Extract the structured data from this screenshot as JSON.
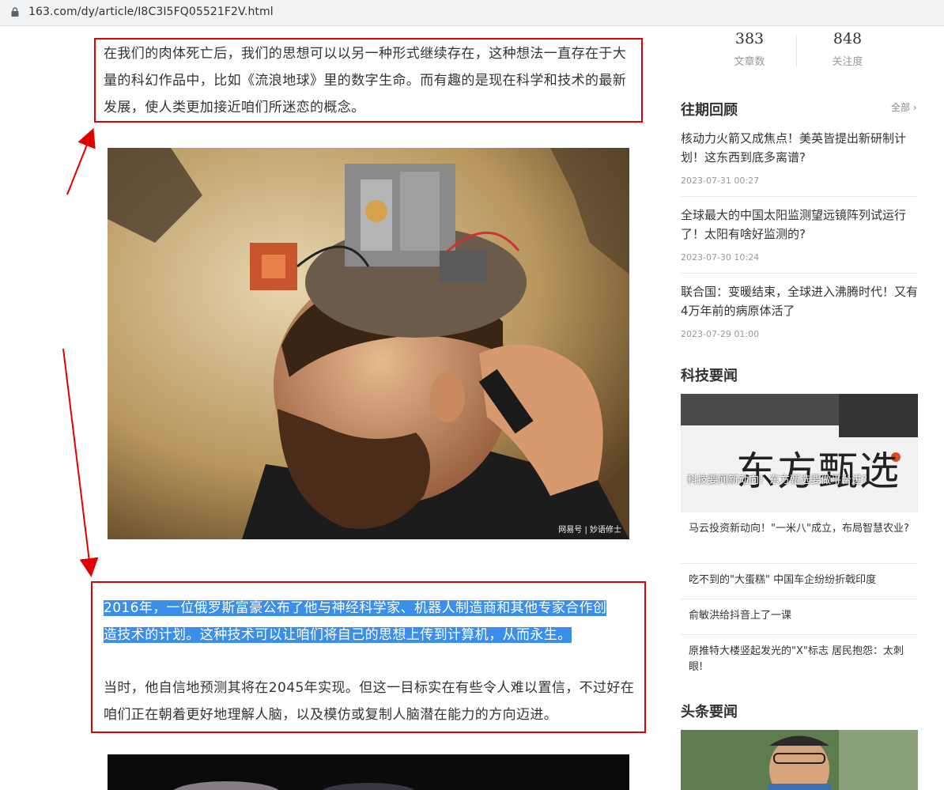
{
  "browser": {
    "url": "163.com/dy/article/I8C3I5FQ05521F2V.html"
  },
  "article": {
    "para1": "在我们的肉体死亡后，我们的思想可以以另一种形式继续存在，这种想法一直存在于大量的科幻作品中，比如《流浪地球》里的数字生命。而有趣的是现在科学和技术的最新发展，使人类更加接近咱们所迷恋的概念。",
    "image1_watermark": "网易号 | 妙语修士",
    "para2_line1": "2016年，一位俄罗斯富豪公布了他与神经科学家、机器人制造商和其他专家合作创",
    "para2_line2": "造技术的计划。这种技术可以让咱们将自己的思想上传到计算机，从而永生。",
    "para3": "当时，他自信地预测其将在2045年实现。但这一目标实在有些令人难以置信，不过好在咱们正在朝着更好地理解人脑，以及模仿或复制人脑潜在能力的方向迈进。"
  },
  "sidebar": {
    "stats": [
      {
        "value": "383",
        "label": "文章数"
      },
      {
        "value": "848",
        "label": "关注度"
      }
    ],
    "past": {
      "title": "往期回顾",
      "more": "全部",
      "items": [
        {
          "title": "核动力火箭又成焦点！美英皆提出新研制计划！这东西到底多离谱?",
          "date": "2023-07-31 00:27"
        },
        {
          "title": "全球最大的中国太阳监测望远镜阵列试运行了！太阳有啥好监测的?",
          "date": "2023-07-30 10:24"
        },
        {
          "title": "联合国：变暖结束，全球进入沸腾时代！又有4万年前的病原体活了",
          "date": "2023-07-29 01:00"
        }
      ]
    },
    "tech": {
      "title": "科技要闻",
      "banner_sign": "东方甄选",
      "banner_caption": "科技要闻新动向！东方甄选要做平台进?",
      "items": [
        {
          "title": "马云投资新动向！\"一米八\"成立，布局智慧农业?"
        },
        {
          "title": "吃不到的\"大蛋糕\" 中国车企纷纷折戟印度"
        },
        {
          "title": "俞敏洪给抖音上了一课"
        },
        {
          "title": "原推特大楼竖起发光的\"X\"标志 居民抱怨：太刺眼!"
        }
      ]
    },
    "headline": {
      "title": "头条要闻"
    }
  },
  "colors": {
    "annotation_red": "#e00000",
    "selection_blue": "#3b8eea"
  }
}
